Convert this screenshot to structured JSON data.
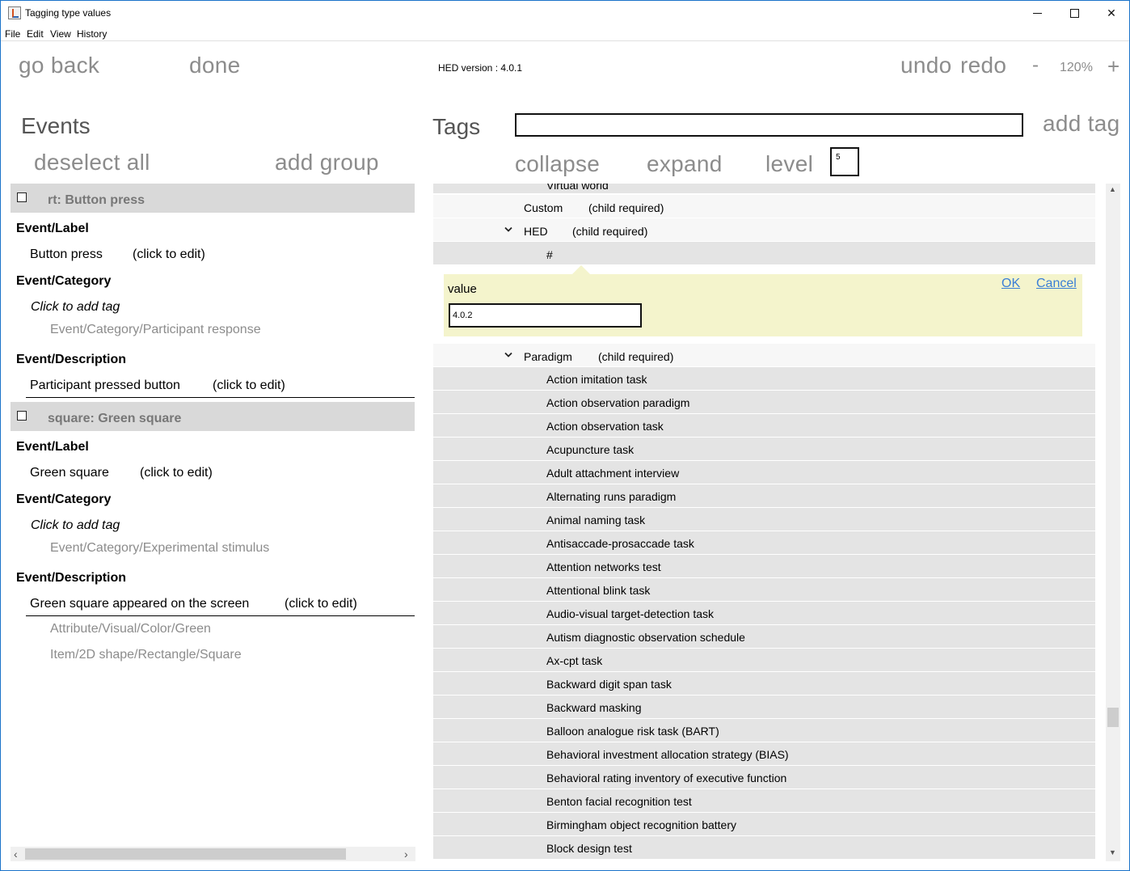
{
  "window": {
    "title": "Tagging type values",
    "close_glyph": "✕"
  },
  "menu": [
    "File",
    "Edit",
    "View",
    "History"
  ],
  "toolbar": {
    "go_back": "go back",
    "done": "done",
    "hed_version": "HED version : 4.0.1",
    "undo": "undo",
    "redo": "redo",
    "zoom_out": "-",
    "zoom": "120%",
    "zoom_in": "+"
  },
  "events": {
    "heading": "Events",
    "deselect_all": "deselect all",
    "add_group": "add group",
    "items": [
      {
        "title": "rt: Button press",
        "label_field": "Event/Label",
        "label_value": "Button press",
        "label_edit": "(click to edit)",
        "category_field": "Event/Category",
        "category_add": "Click to add tag",
        "category_value": "Event/Category/Participant response",
        "description_field": "Event/Description",
        "description_value": "Participant pressed button",
        "description_edit": "(click to edit)",
        "extra_tags": []
      },
      {
        "title": "square: Green square",
        "label_field": "Event/Label",
        "label_value": "Green square",
        "label_edit": "(click to edit)",
        "category_field": "Event/Category",
        "category_add": "Click to add tag",
        "category_value": "Event/Category/Experimental stimulus",
        "description_field": "Event/Description",
        "description_value": "Green square appeared on the screen",
        "description_edit": "(click to edit)",
        "extra_tags": [
          "Attribute/Visual/Color/Green",
          "Item/2D shape/Rectangle/Square"
        ]
      }
    ]
  },
  "tags": {
    "heading": "Tags",
    "search_value": "",
    "add_tag": "add tag",
    "collapse": "collapse",
    "expand": "expand",
    "level_label": "level",
    "level_value": "5",
    "partial_top": "Virtual world",
    "custom": {
      "name": "Custom",
      "note": "(child required)"
    },
    "hed": {
      "name": "HED",
      "note": "(child required)"
    },
    "hed_child": "#",
    "value_editor": {
      "label": "value",
      "input_value": "4.0.2",
      "ok": "OK",
      "cancel": "Cancel"
    },
    "paradigm": {
      "name": "Paradigm",
      "note": "(child required)"
    },
    "paradigm_children": [
      "Action imitation task",
      "Action observation paradigm",
      "Action observation task",
      "Acupuncture task",
      "Adult attachment interview",
      "Alternating runs paradigm",
      "Animal naming task",
      "Antisaccade-prosaccade task",
      "Attention networks test",
      "Attentional blink task",
      "Audio-visual target-detection task",
      "Autism diagnostic observation schedule",
      "Ax-cpt task",
      "Backward digit span task",
      "Backward masking",
      "Balloon analogue risk task (BART)",
      "Behavioral investment allocation strategy (BIAS)",
      "Behavioral rating inventory of executive function",
      "Benton facial recognition test",
      "Birmingham object recognition battery",
      "Block design test"
    ]
  },
  "scroll": {
    "up": "▲",
    "down": "▼",
    "left": "‹",
    "right": "›"
  }
}
